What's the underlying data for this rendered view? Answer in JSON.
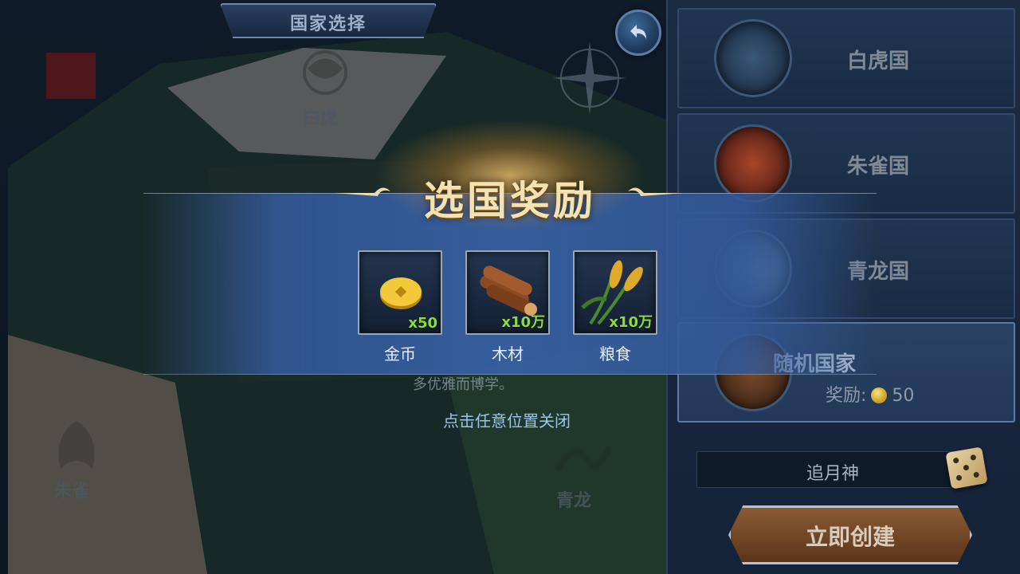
{
  "header": {
    "title": "国家选择"
  },
  "map": {
    "labels": {
      "tiger": "白虎",
      "phoenix": "朱雀",
      "dragon": "青龙"
    },
    "description": "多优雅而博学。"
  },
  "nations": [
    {
      "name": "白虎国"
    },
    {
      "name": "朱雀国"
    },
    {
      "name": "青龙国"
    },
    {
      "name": "随机国家",
      "reward_label": "奖励:",
      "reward_amount": "50"
    }
  ],
  "player": {
    "name": "追月神"
  },
  "create_button": {
    "label": "立即创建"
  },
  "popup": {
    "title": "选国奖励",
    "items": [
      {
        "name": "金币",
        "qty": "x50"
      },
      {
        "name": "木材",
        "qty": "x10万"
      },
      {
        "name": "粮食",
        "qty": "x10万"
      }
    ],
    "close_hint": "点击任意位置关闭"
  },
  "colors": {
    "popup_band": "#375fa2",
    "qty_green": "#8ddc3a",
    "title_gold": "#f4e3b0",
    "create_button": "#8a5a34"
  }
}
